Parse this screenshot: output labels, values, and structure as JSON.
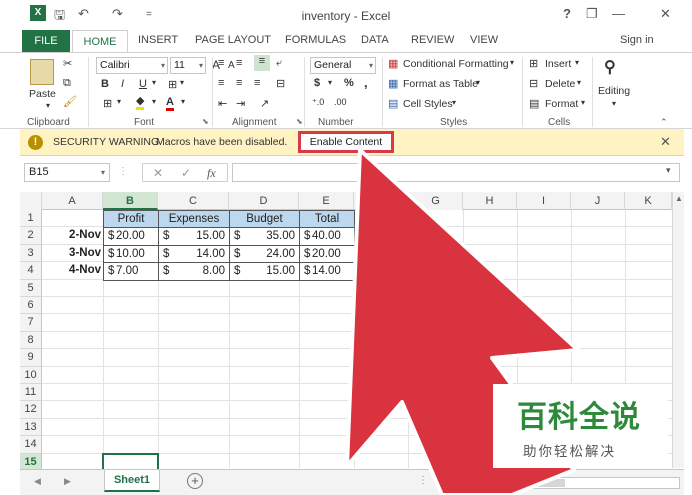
{
  "window": {
    "title": "inventory - Excel",
    "help": "?",
    "restore": "❐",
    "minimize": "—",
    "close": "✕"
  },
  "quick_access": {
    "app_icon": "X",
    "save": "🖫",
    "undo": "↶",
    "redo": "↷",
    "customize": "="
  },
  "tabs": {
    "file": "FILE",
    "items": [
      "HOME",
      "INSERT",
      "PAGE LAYOUT",
      "FORMULAS",
      "DATA",
      "REVIEW",
      "VIEW"
    ],
    "sign_in": "Sign in"
  },
  "ribbon": {
    "clipboard": {
      "label": "Clipboard",
      "paste": "Paste"
    },
    "font": {
      "label": "Font",
      "name": "Calibri",
      "size": "11",
      "bold": "B",
      "italic": "I",
      "underline": "U"
    },
    "alignment": {
      "label": "Alignment"
    },
    "number": {
      "label": "Number",
      "format": "General",
      "currency": "$",
      "percent": "%",
      "comma": ","
    },
    "styles": {
      "label": "Styles",
      "conditional": "Conditional Formatting",
      "table": "Format as Table",
      "cell_styles": "Cell Styles"
    },
    "cells": {
      "label": "Cells",
      "insert": "Insert",
      "delete": "Delete",
      "format": "Format"
    },
    "editing": {
      "label": "Editing"
    }
  },
  "security": {
    "title": "SECURITY WARNING",
    "message": "Macros have been disabled.",
    "button": "Enable Content",
    "close": "✕"
  },
  "formula_bar": {
    "name_box": "B15",
    "cancel": "✕",
    "enter": "✓",
    "fx": "fx",
    "value": ""
  },
  "columns": [
    "A",
    "B",
    "C",
    "D",
    "E",
    "F",
    "G",
    "H",
    "I",
    "J",
    "K"
  ],
  "rows": [
    "1",
    "2",
    "3",
    "4",
    "5",
    "6",
    "7",
    "8",
    "9",
    "10",
    "11",
    "12",
    "13",
    "14",
    "15"
  ],
  "table": {
    "headers": [
      "Profit",
      "Expenses",
      "Budget",
      "Total"
    ],
    "dates": [
      "2-Nov",
      "3-Nov",
      "4-Nov"
    ],
    "data": [
      [
        {
          "c": "$",
          "v": "20.00",
          "m": true
        },
        {
          "c": "$",
          "v": "15.00",
          "m": false
        },
        {
          "c": "$",
          "v": "35.00",
          "m": false
        },
        {
          "c": "$",
          "v": "40.00",
          "m": true
        }
      ],
      [
        {
          "c": "$",
          "v": "10.00",
          "m": true
        },
        {
          "c": "$",
          "v": "14.00",
          "m": false
        },
        {
          "c": "$",
          "v": "24.00",
          "m": false
        },
        {
          "c": "$",
          "v": "20.00",
          "m": true
        }
      ],
      [
        {
          "c": "$",
          "v": "7.00",
          "m": true
        },
        {
          "c": "$",
          "v": "8.00",
          "m": false
        },
        {
          "c": "$",
          "v": "15.00",
          "m": false
        },
        {
          "c": "$",
          "v": "14.00",
          "m": true
        }
      ]
    ]
  },
  "sheets": {
    "active": "Sheet1",
    "add": "+"
  },
  "watermark": {
    "line1": "百科全说",
    "line2": "助你轻松解决"
  },
  "colors": {
    "excel_green": "#217346",
    "header_fill": "#bdd7ee",
    "arrow_red": "#d9333f",
    "warning_bar": "#fff3c4"
  }
}
